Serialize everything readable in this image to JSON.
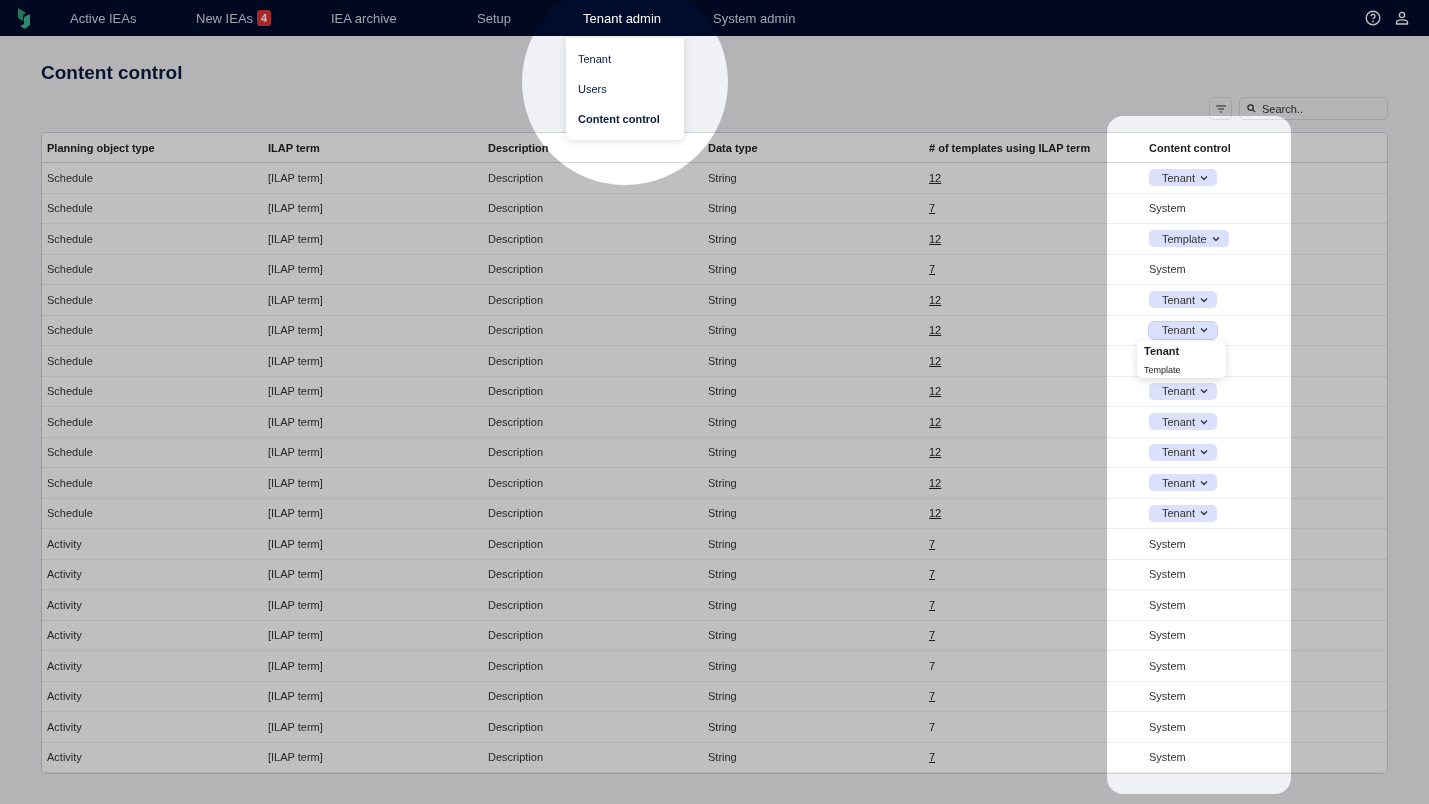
{
  "nav": {
    "items": [
      {
        "label": "Active IEAs",
        "selected": false
      },
      {
        "label": "New IEAs",
        "selected": false,
        "badge": "4"
      },
      {
        "label": "IEA archive",
        "selected": false
      },
      {
        "label": "Setup",
        "selected": false
      },
      {
        "label": "Tenant admin",
        "selected": true,
        "menu": [
          {
            "label": "Tenant",
            "selected": false
          },
          {
            "label": "Users",
            "selected": false
          },
          {
            "label": "Content control",
            "selected": true
          }
        ]
      },
      {
        "label": "System admin",
        "selected": false
      }
    ]
  },
  "page": {
    "title": "Content control",
    "search": {
      "placeholder": "Search.."
    }
  },
  "table": {
    "columns": [
      "Planning object type",
      "ILAP term",
      "Description",
      "Data type",
      "# of templates using ILAP term",
      "Content control"
    ],
    "rows": [
      {
        "type": "Schedule",
        "term": "[ILAP term]",
        "description": "Description",
        "data_type": "String",
        "templates": "12",
        "link": true,
        "control": {
          "kind": "select",
          "value": "Tenant"
        }
      },
      {
        "type": "Schedule",
        "term": "[ILAP term]",
        "description": "Description",
        "data_type": "String",
        "templates": "7",
        "link": true,
        "control": {
          "kind": "text",
          "value": "System"
        }
      },
      {
        "type": "Schedule",
        "term": "[ILAP term]",
        "description": "Description",
        "data_type": "String",
        "templates": "12",
        "link": true,
        "control": {
          "kind": "select",
          "value": "Template"
        }
      },
      {
        "type": "Schedule",
        "term": "[ILAP term]",
        "description": "Description",
        "data_type": "String",
        "templates": "7",
        "link": true,
        "control": {
          "kind": "text",
          "value": "System"
        }
      },
      {
        "type": "Schedule",
        "term": "[ILAP term]",
        "description": "Description",
        "data_type": "String",
        "templates": "12",
        "link": true,
        "control": {
          "kind": "select",
          "value": "Tenant"
        }
      },
      {
        "type": "Schedule",
        "term": "[ILAP term]",
        "description": "Description",
        "data_type": "String",
        "templates": "12",
        "link": true,
        "control": {
          "kind": "select",
          "value": "Tenant",
          "expanded": true,
          "options": [
            {
              "label": "Tenant",
              "selected": true
            },
            {
              "label": "Template",
              "selected": false
            }
          ]
        }
      },
      {
        "type": "Schedule",
        "term": "[ILAP term]",
        "description": "Description",
        "data_type": "String",
        "templates": "12",
        "link": true
      },
      {
        "type": "Schedule",
        "term": "[ILAP term]",
        "description": "Description",
        "data_type": "String",
        "templates": "12",
        "link": true,
        "control": {
          "kind": "select",
          "value": "Tenant"
        }
      },
      {
        "type": "Schedule",
        "term": "[ILAP term]",
        "description": "Description",
        "data_type": "String",
        "templates": "12",
        "link": true,
        "control": {
          "kind": "select",
          "value": "Tenant"
        }
      },
      {
        "type": "Schedule",
        "term": "[ILAP term]",
        "description": "Description",
        "data_type": "String",
        "templates": "12",
        "link": true,
        "control": {
          "kind": "select",
          "value": "Tenant"
        }
      },
      {
        "type": "Schedule",
        "term": "[ILAP term]",
        "description": "Description",
        "data_type": "String",
        "templates": "12",
        "link": true,
        "control": {
          "kind": "select",
          "value": "Tenant"
        }
      },
      {
        "type": "Schedule",
        "term": "[ILAP term]",
        "description": "Description",
        "data_type": "String",
        "templates": "12",
        "link": true,
        "control": {
          "kind": "select",
          "value": "Tenant"
        }
      },
      {
        "type": "Activity",
        "term": "[ILAP term]",
        "description": "Description",
        "data_type": "String",
        "templates": "7",
        "link": true,
        "control": {
          "kind": "text",
          "value": "System"
        }
      },
      {
        "type": "Activity",
        "term": "[ILAP term]",
        "description": "Description",
        "data_type": "String",
        "templates": "7",
        "link": true,
        "control": {
          "kind": "text",
          "value": "System"
        }
      },
      {
        "type": "Activity",
        "term": "[ILAP term]",
        "description": "Description",
        "data_type": "String",
        "templates": "7",
        "link": true,
        "control": {
          "kind": "text",
          "value": "System"
        }
      },
      {
        "type": "Activity",
        "term": "[ILAP term]",
        "description": "Description",
        "data_type": "String",
        "templates": "7",
        "link": true,
        "control": {
          "kind": "text",
          "value": "System"
        }
      },
      {
        "type": "Activity",
        "term": "[ILAP term]",
        "description": "Description",
        "data_type": "String",
        "templates": "7",
        "link": false,
        "control": {
          "kind": "text",
          "value": "System"
        }
      },
      {
        "type": "Activity",
        "term": "[ILAP term]",
        "description": "Description",
        "data_type": "String",
        "templates": "7",
        "link": true,
        "control": {
          "kind": "text",
          "value": "System"
        }
      },
      {
        "type": "Activity",
        "term": "[ILAP term]",
        "description": "Description",
        "data_type": "String",
        "templates": "7",
        "link": false,
        "control": {
          "kind": "text",
          "value": "System"
        }
      },
      {
        "type": "Activity",
        "term": "[ILAP term]",
        "description": "Description",
        "data_type": "String",
        "templates": "7",
        "link": true,
        "control": {
          "kind": "text",
          "value": "System"
        }
      }
    ]
  }
}
